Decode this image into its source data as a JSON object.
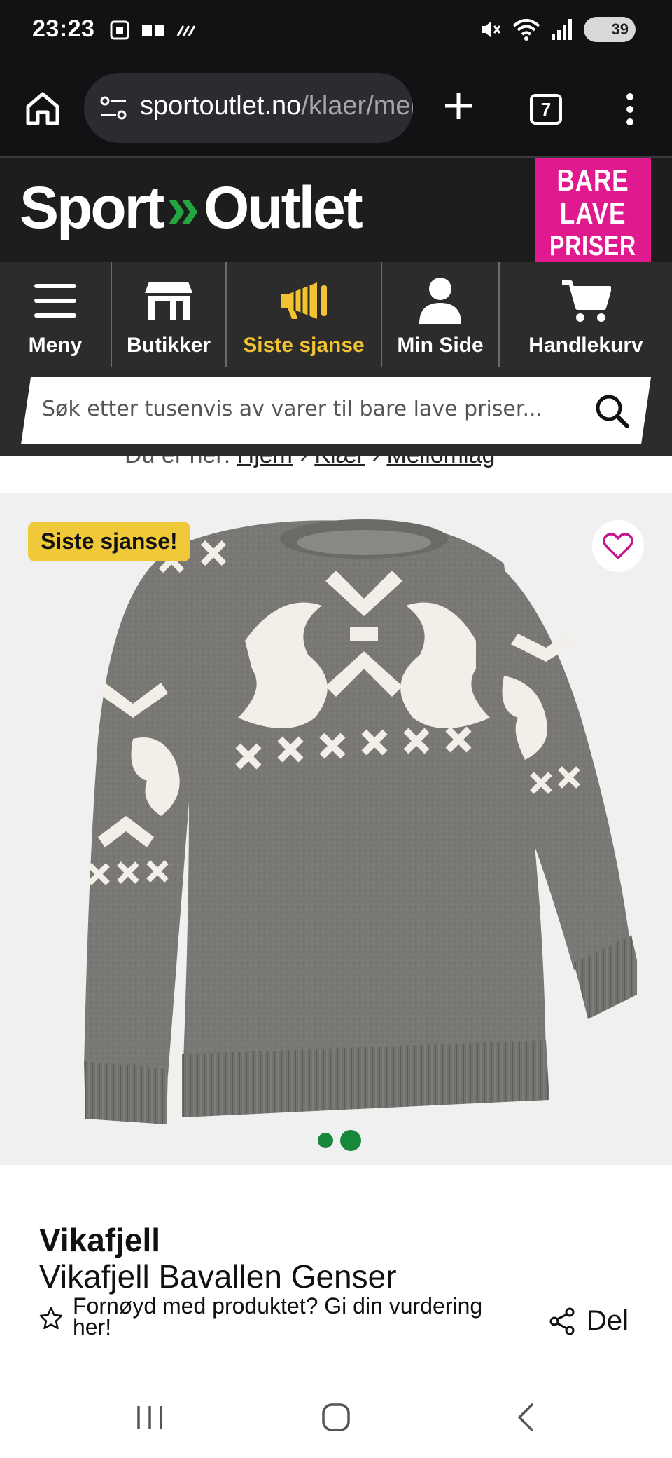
{
  "status_bar": {
    "time": "23:23",
    "battery": "39"
  },
  "browser": {
    "url_domain": "sportoutlet.no",
    "url_path": "/klaer/mellomlag",
    "tab_count": "7"
  },
  "site": {
    "logo_left": "Sport",
    "logo_chevron": "»",
    "logo_right": "Outlet",
    "promo_line1": "BARE",
    "promo_line2": "LAVE",
    "promo_line3": "PRISER"
  },
  "nav": {
    "items": [
      {
        "label": "Meny",
        "icon": "hamburger-icon"
      },
      {
        "label": "Butikker",
        "icon": "store-icon"
      },
      {
        "label": "Siste sjanse",
        "icon": "megaphone-icon"
      },
      {
        "label": "Min Side",
        "icon": "user-icon"
      },
      {
        "label": "Handlekurv",
        "icon": "cart-icon"
      }
    ],
    "active_color": "#f1c232"
  },
  "search": {
    "placeholder": "Søk etter tusenvis av varer til bare lave priser..."
  },
  "breadcrumb": {
    "prefix": "Du er her:",
    "items": [
      "Hjem",
      "Klær",
      "Mellomlag"
    ],
    "separator": "›"
  },
  "product": {
    "badge": "Siste sjanse!",
    "brand": "Vikafjell",
    "title": "Vikafjell Bavallen Genser",
    "rating_prompt": "Fornøyd med produktet? Gi din vurdering her!",
    "share_label": "Del",
    "image_count": 2,
    "active_image": 2
  },
  "colors": {
    "brand_green": "#23a540",
    "promo_pink": "#e0198e",
    "badge_yellow": "#f0c93a",
    "favorite_pink": "#c5168b",
    "dot_green": "#17873a"
  }
}
